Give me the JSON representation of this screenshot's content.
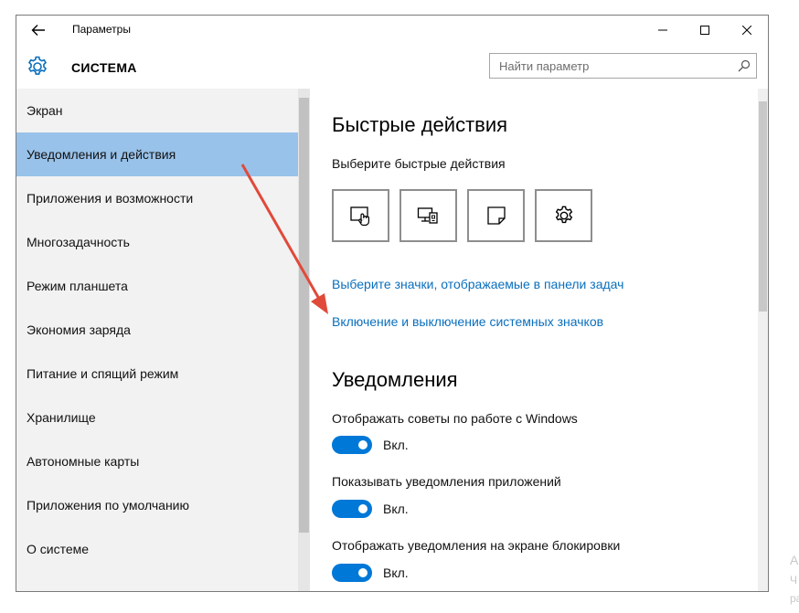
{
  "window": {
    "title": "Параметры",
    "back_icon": "back-arrow-icon",
    "caption_buttons": [
      "minimize-icon",
      "maximize-icon",
      "close-icon"
    ]
  },
  "header": {
    "section_title": "СИСТЕМА",
    "icon": "gear-icon",
    "search": {
      "placeholder": "Найти параметр",
      "icon": "search-icon"
    }
  },
  "sidebar": {
    "items": [
      {
        "label": "Экран"
      },
      {
        "label": "Уведомления и действия",
        "active": true
      },
      {
        "label": "Приложения и возможности"
      },
      {
        "label": "Многозадачность"
      },
      {
        "label": "Режим планшета"
      },
      {
        "label": "Экономия заряда"
      },
      {
        "label": "Питание и спящий режим"
      },
      {
        "label": "Хранилище"
      },
      {
        "label": "Автономные карты"
      },
      {
        "label": "Приложения по умолчанию"
      },
      {
        "label": "О системе"
      }
    ],
    "active_color": "#98c2e9"
  },
  "content": {
    "quick_actions": {
      "heading": "Быстрые действия",
      "subtitle": "Выберите быстрые действия",
      "buttons": [
        "tablet-mode-icon",
        "project-icon",
        "note-icon",
        "settings-icon"
      ]
    },
    "links": [
      "Выберите значки, отображаемые в панели задач",
      "Включение и выключение системных значков"
    ],
    "notifications": {
      "heading": "Уведомления",
      "toggles": [
        {
          "label": "Отображать советы по работе с Windows",
          "state": "Вкл."
        },
        {
          "label": "Показывать уведомления приложений",
          "state": "Вкл."
        },
        {
          "label": "Отображать уведомления на экране блокировки",
          "state": "Вкл."
        }
      ]
    }
  },
  "colors": {
    "accent": "#0078d7",
    "link": "#0a6fbd",
    "annotation_arrow": "#e04a3a"
  },
  "outside_text": [
    "А",
    "Ч",
    "ра"
  ]
}
